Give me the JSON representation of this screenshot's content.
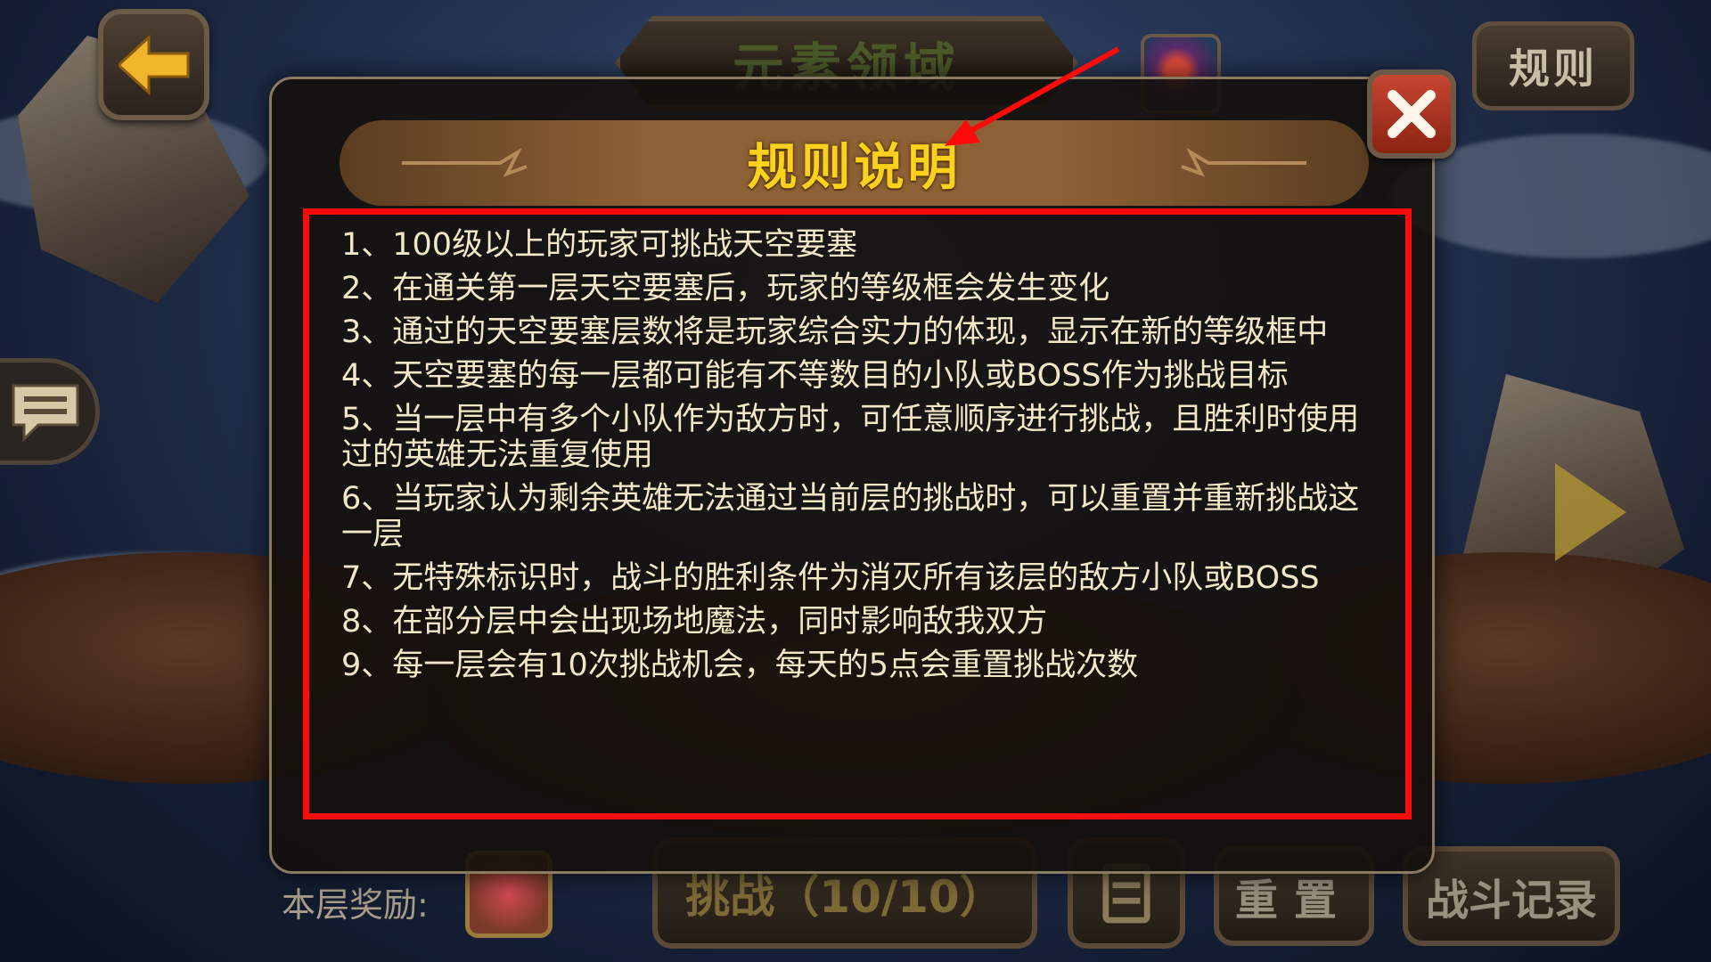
{
  "top_bar": {
    "title": "元素领域",
    "rules_button": "规则"
  },
  "dialog": {
    "title": "规则说明",
    "rules": [
      "1、100级以上的玩家可挑战天空要塞",
      "2、在通关第一层天空要塞后，玩家的等级框会发生变化",
      "3、通过的天空要塞层数将是玩家综合实力的体现，显示在新的等级框中",
      "4、天空要塞的每一层都可能有不等数目的小队或BOSS作为挑战目标",
      "5、当一层中有多个小队作为敌方时，可任意顺序进行挑战，且胜利时使用过的英雄无法重复使用",
      "6、当玩家认为剩余英雄无法通过当前层的挑战时，可以重置并重新挑战这一层",
      "7、无特殊标识时，战斗的胜利条件为消灭所有该层的敌方小队或BOSS",
      "8、在部分层中会出现场地魔法，同时影响敌我双方",
      "9、每一层会有10次挑战机会，每天的5点会重置挑战次数"
    ]
  },
  "bottom_bar": {
    "reward_label": "本层奖励:",
    "challenge_button": "挑战（10/10）",
    "reset_button": "重置",
    "battle_log_button": "战斗记录"
  },
  "colors": {
    "title_yellow": "#fad21e",
    "highlight_red": "#ff0a0a",
    "rule_text": "#f2e7c6"
  },
  "icons": [
    "back-arrow-icon",
    "close-icon",
    "chat-icon",
    "next-arrow-icon",
    "book-icon"
  ]
}
